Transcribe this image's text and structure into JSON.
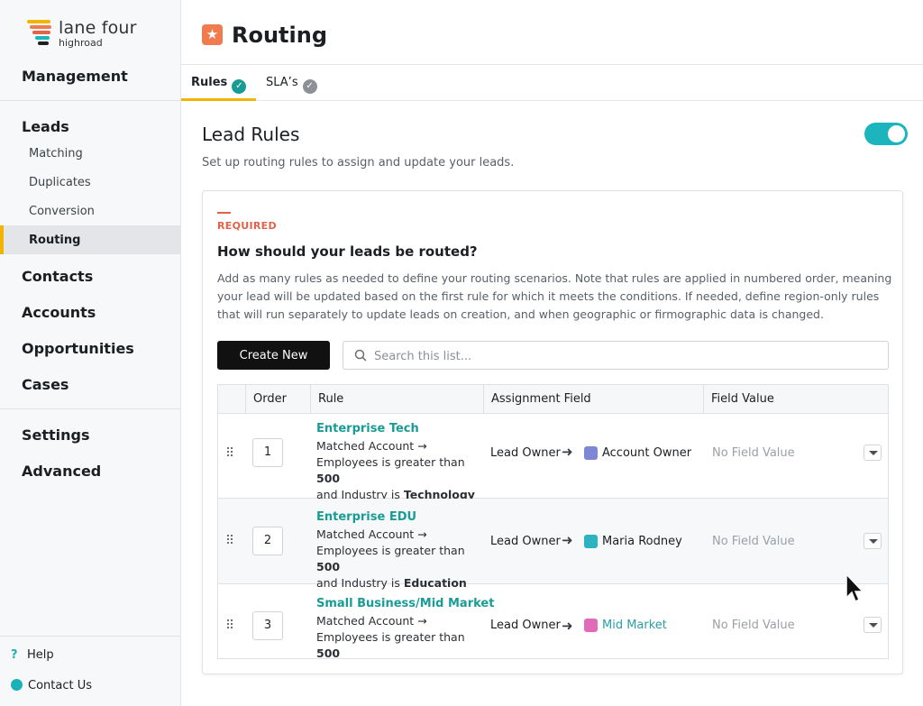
{
  "brand": {
    "name": "lane four",
    "sub": "highroad"
  },
  "sidebar": {
    "management": "Management",
    "leads": "Leads",
    "lead_items": [
      "Matching",
      "Duplicates",
      "Conversion"
    ],
    "active_item": "Routing",
    "contacts": "Contacts",
    "accounts": "Accounts",
    "opportunities": "Opportunities",
    "cases": "Cases",
    "settings": "Settings",
    "advanced": "Advanced",
    "help": "Help",
    "contact_us": "Contact Us"
  },
  "header": {
    "title": "Routing"
  },
  "tabs": [
    {
      "label": "Rules",
      "status": "complete"
    },
    {
      "label": "SLA’s",
      "status": "complete"
    }
  ],
  "lead_rules": {
    "title": "Lead Rules",
    "description": "Set up routing rules to assign and update your leads.",
    "enabled": true
  },
  "card": {
    "required_label": "REQUIRED",
    "question": "How should your leads be routed?",
    "description": "Add as many rules as needed to define your routing scenarios. Note that rules are applied in numbered order, meaning your lead will be updated based on the first rule for which it meets the conditions. If needed, define region-only rules that will run separately to update leads on creation, and when geographic or firmographic data is changed.",
    "create_label": "Create New",
    "search_placeholder": "Search this list..."
  },
  "table": {
    "columns": [
      "Order",
      "Rule",
      "Assignment Field",
      "Field Value"
    ],
    "rows": [
      {
        "order": "1",
        "name": "Enterprise Tech",
        "line1": "Matched Account →",
        "line2_prefix": "Employees is greater than ",
        "line2_value": "500",
        "line3_prefix": "and Industry is ",
        "line3_value": "Technology",
        "assign": "Lead Owner",
        "value": "Account Owner",
        "value_icon": "account-icon",
        "field_value": "No Field Value"
      },
      {
        "order": "2",
        "name": "Enterprise EDU",
        "line1": "Matched Account →",
        "line2_prefix": "Employees is greater than ",
        "line2_value": "500",
        "line3_prefix": "and Industry is ",
        "line3_value": "Education",
        "assign": "Lead Owner",
        "value": "Maria Rodney",
        "value_icon": "user-icon",
        "field_value": "No Field Value"
      },
      {
        "order": "3",
        "name": "Small Business/Mid Market",
        "line1": "Matched Account →",
        "line2_prefix": "Employees is greater than ",
        "line2_value": "500",
        "assign": "Lead Owner",
        "value": "Mid Market",
        "value_icon": "queue-icon",
        "field_value": "No Field Value"
      }
    ]
  },
  "colors": {
    "accent_yellow": "#f2b400",
    "teal": "#199c96",
    "toggle": "#1cb5bd",
    "required": "#e0634a",
    "page_icon": "#f07b4f"
  }
}
